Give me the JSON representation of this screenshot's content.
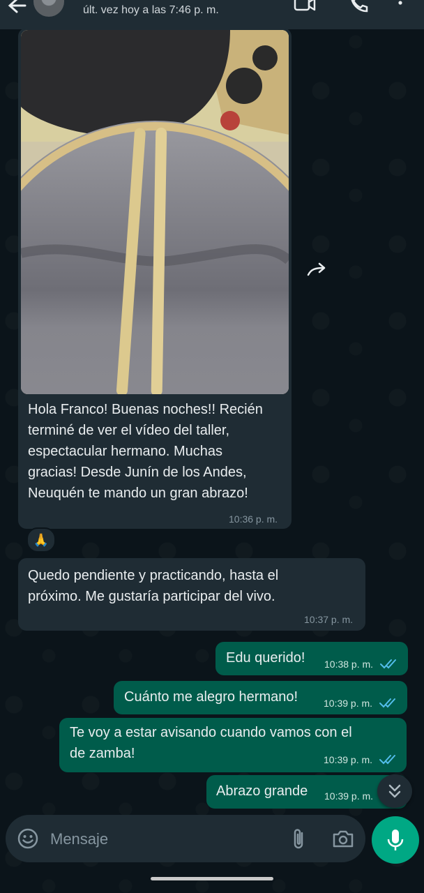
{
  "header": {
    "status": "últ. vez hoy a las 7:46 p. m."
  },
  "messages": {
    "incoming_image": {
      "text": "Hola Franco! Buenas noches!! Recién\nterminé de ver el vídeo del taller,\nespectacular hermano. Muchas\ngracias! Desde Junín de los Andes,\nNeuquén te mando un gran abrazo!",
      "time": "10:36 p. m.",
      "reaction": "🙏"
    },
    "incoming_text": {
      "text": "Quedo pendiente y practicando, hasta el\npróximo. Me gustaría participar del vivo.",
      "time": "10:37 p. m."
    },
    "outgoing": [
      {
        "text": "Edu querido!",
        "time": "10:38 p. m."
      },
      {
        "text": "Cuánto me alegro hermano!",
        "time": "10:39 p. m."
      },
      {
        "text": "Te voy a estar avisando cuando vamos con el\nde zamba!",
        "time": "10:39 p. m."
      },
      {
        "text": "Abrazo grande",
        "time": "10:39 p. m."
      }
    ]
  },
  "composer": {
    "placeholder": "Mensaje"
  },
  "icons": {
    "back": "arrow-left-icon",
    "video": "video-call-icon",
    "call": "phone-icon",
    "menu": "more-vert-icon",
    "forward": "forward-icon",
    "scroll": "double-chevron-down-icon",
    "emoji": "emoji-icon",
    "attach": "paperclip-icon",
    "camera": "camera-icon",
    "mic": "microphone-icon"
  },
  "colors": {
    "background": "#0b141a",
    "incoming_bubble": "#1f2c34",
    "outgoing_bubble": "#005c4b",
    "read_ticks": "#53bdeb",
    "accent": "#00a884"
  }
}
